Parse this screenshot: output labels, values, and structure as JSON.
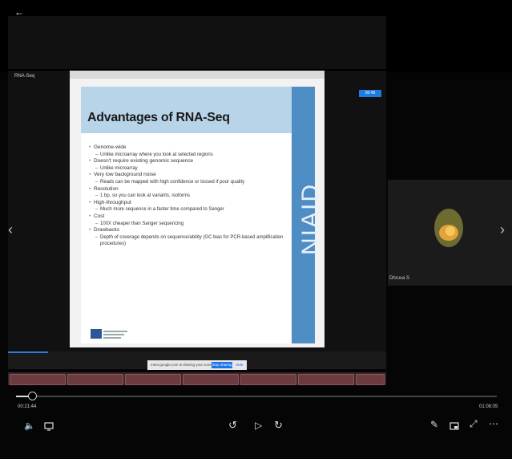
{
  "top_bar": {
    "back_icon": "arrow-left-icon"
  },
  "presenter_label": "RNA-Seq",
  "slide": {
    "title": "Advantages of RNA-Seq",
    "band_text": "NIAID",
    "bullets": [
      {
        "text": "Genome-wide",
        "subs": [
          "Unlike microarray where you look at selected regions"
        ]
      },
      {
        "text": "Doesn't require existing genomic sequence",
        "subs": [
          "Unlike microarray"
        ]
      },
      {
        "text": "Very low background noise",
        "subs": [
          "Reads can be mapped with high confidence or tossed if poor quality"
        ]
      },
      {
        "text": "Resolution",
        "subs": [
          "1 bp, so you can look at variants, isoforms"
        ]
      },
      {
        "text": "High-throughput",
        "subs": [
          "Much more sequence in a faster time compared to Sanger"
        ]
      },
      {
        "text": "Cost",
        "subs": [
          "100X cheaper than Sanger sequencing"
        ]
      },
      {
        "text": "Drawbacks",
        "subs": [
          "Depth of coverage depends on sequence/ability (GC bias for PCR-based amplification procedures)"
        ]
      }
    ]
  },
  "badge": "00:48",
  "participant_name": "Dhruva S",
  "share_bar": {
    "message": "meet.google.com is sharing your screen.",
    "stop_label": "Stop sharing",
    "hide_label": "Hide"
  },
  "player": {
    "current_time": "00:21:44",
    "duration": "01:08:05"
  }
}
